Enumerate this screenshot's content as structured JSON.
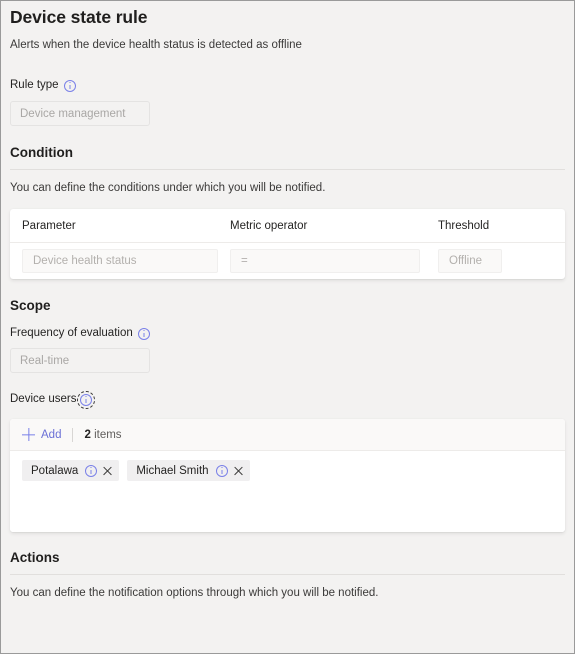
{
  "header": {
    "title": "Device state rule",
    "subtitle": "Alerts when the device health status is detected as offline"
  },
  "rule_type": {
    "label": "Rule type",
    "info_icon": "info-icon",
    "value": "Device management"
  },
  "condition": {
    "title": "Condition",
    "description": "You can define the conditions under which you will be notified.",
    "columns": [
      "Parameter",
      "Metric operator",
      "Threshold"
    ],
    "rows": [
      {
        "parameter": "Device health status",
        "operator": "=",
        "threshold": "Offline"
      }
    ]
  },
  "scope": {
    "title": "Scope",
    "frequency_label": "Frequency of evaluation",
    "frequency_info_icon": "info-icon",
    "frequency_value": "Real-time",
    "device_users_label": "Device users",
    "device_users_info_icon": "info-icon-focused",
    "toolbar": {
      "add_label": "Add",
      "add_icon": "plus-icon",
      "items_count": "2",
      "items_label": "items"
    },
    "users": [
      {
        "name": "Potalawa",
        "info_icon": "info-icon",
        "remove_icon": "close-icon"
      },
      {
        "name": "Michael Smith",
        "info_icon": "info-icon",
        "remove_icon": "close-icon"
      }
    ]
  },
  "actions": {
    "title": "Actions",
    "description": "You can define the notification options through which you will be notified."
  },
  "colors": {
    "accent": "#7a81e8",
    "page_background": "#f3f2f1",
    "card_background": "#ffffff",
    "text_primary": "#252423",
    "text_muted": "#b3b0ad",
    "divider": "#e1dfdd"
  }
}
